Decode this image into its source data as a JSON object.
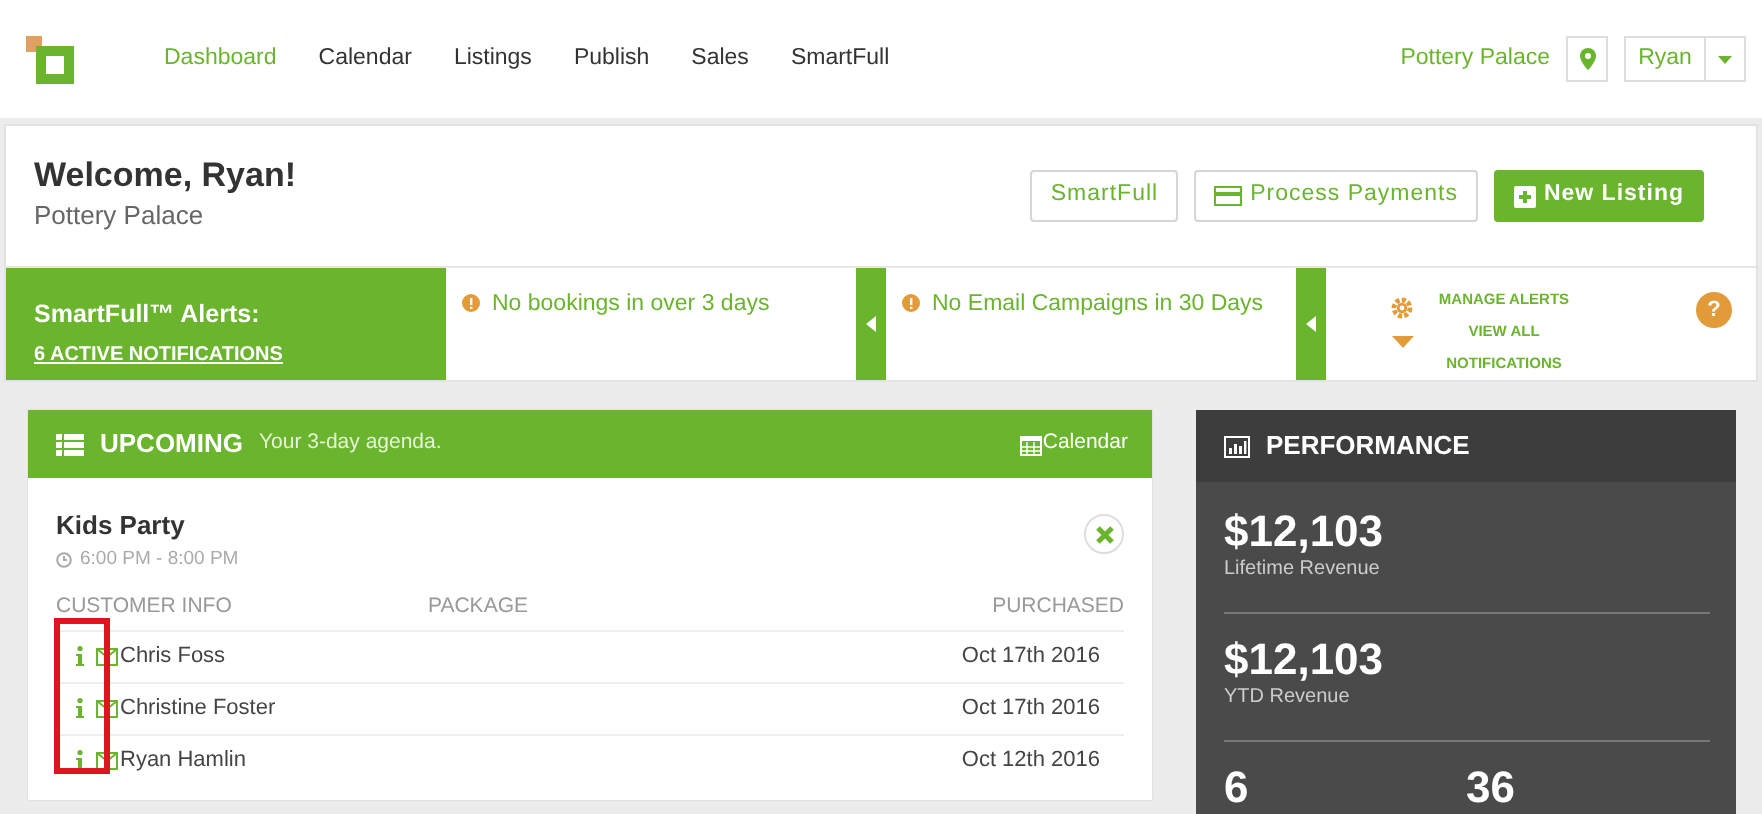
{
  "nav": {
    "items": [
      {
        "label": "Dashboard",
        "selected": true
      },
      {
        "label": "Calendar",
        "selected": false
      },
      {
        "label": "Listings",
        "selected": false
      },
      {
        "label": "Publish",
        "selected": false
      },
      {
        "label": "Sales",
        "selected": false
      },
      {
        "label": "SmartFull",
        "selected": false
      }
    ],
    "location": "Pottery Palace",
    "user": "Ryan"
  },
  "header": {
    "title": "Welcome, Ryan!",
    "subtitle": "Pottery Palace",
    "buttons": [
      {
        "label": "SmartFull",
        "kind": "outline"
      },
      {
        "label": "Process Payments",
        "kind": "payments"
      },
      {
        "label": "New Listing",
        "kind": "primary"
      }
    ]
  },
  "alerts": {
    "title": "SmartFull™ Alerts:",
    "link": "6 ACTIVE NOTIFICATIONS",
    "items": [
      "No bookings in over 3 days",
      "No Email Campaigns in 30 Days"
    ],
    "manage": "MANAGE ALERTS",
    "view_all": "VIEW ALL NOTIFICATIONS",
    "help": "?"
  },
  "upcoming": {
    "title": "UPCOMING",
    "subtitle": "Your 3-day agenda.",
    "calendar_link": "Calendar",
    "event": {
      "title": "Kids Party",
      "time": "6:00 PM - 8:00 PM"
    },
    "columns": [
      "CUSTOMER INFO",
      "PACKAGE",
      "PURCHASED"
    ],
    "rows": [
      {
        "name": "Chris Foss",
        "purchased": "Oct 17th 2016"
      },
      {
        "name": "Christine Foster",
        "purchased": "Oct 17th 2016"
      },
      {
        "name": "Ryan Hamlin",
        "purchased": "Oct 12th 2016"
      }
    ]
  },
  "performance": {
    "title": "PERFORMANCE",
    "stats": [
      {
        "value": "$12,103",
        "label": "Lifetime Revenue"
      },
      {
        "value": "$12,103",
        "label": "YTD Revenue"
      }
    ],
    "counts": [
      "6",
      "36"
    ]
  }
}
